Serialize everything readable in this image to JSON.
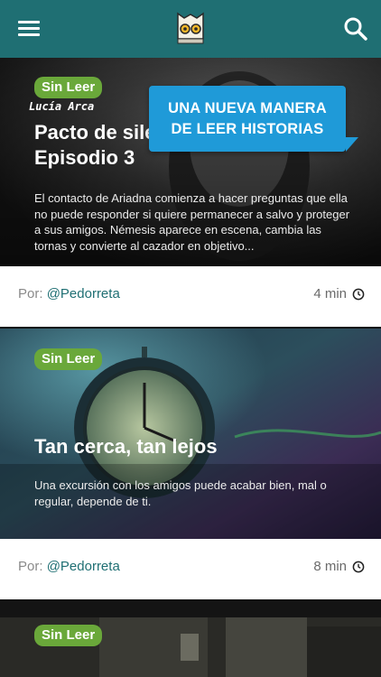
{
  "header": {
    "menu_icon": "menu-icon",
    "logo_icon": "owl-logo-icon",
    "search_icon": "search-icon",
    "color": "#1f6f73"
  },
  "banner": {
    "line1": "UNA NUEVA MANERA",
    "line2": "DE LEER HISTORIAS"
  },
  "stories": [
    {
      "badge": "Sin Leer",
      "overlay_author": "Lucía Arca",
      "title_line1": "Pacto de silencio",
      "title_line2": "Episodio 3",
      "description": "El contacto de Ariadna comienza a hacer preguntas que ella no puede responder si quiere permanecer a salvo y proteger a sus amigos. Némesis aparece en escena, cambia las tornas y convierte al cazador en objetivo...",
      "by_label": "Por:",
      "author": "@Pedorreta",
      "duration": "4 min"
    },
    {
      "badge": "Sin Leer",
      "title_line1": "Tan cerca, tan lejos",
      "description": "Una excursión con los amigos puede acabar bien, mal o regular, depende de ti.",
      "by_label": "Por:",
      "author": "@Pedorreta",
      "duration": "8 min"
    },
    {
      "badge": "Sin Leer"
    }
  ],
  "colors": {
    "badge": "#6aa83a",
    "banner": "#1f9ad8",
    "link": "#1f6f73"
  }
}
